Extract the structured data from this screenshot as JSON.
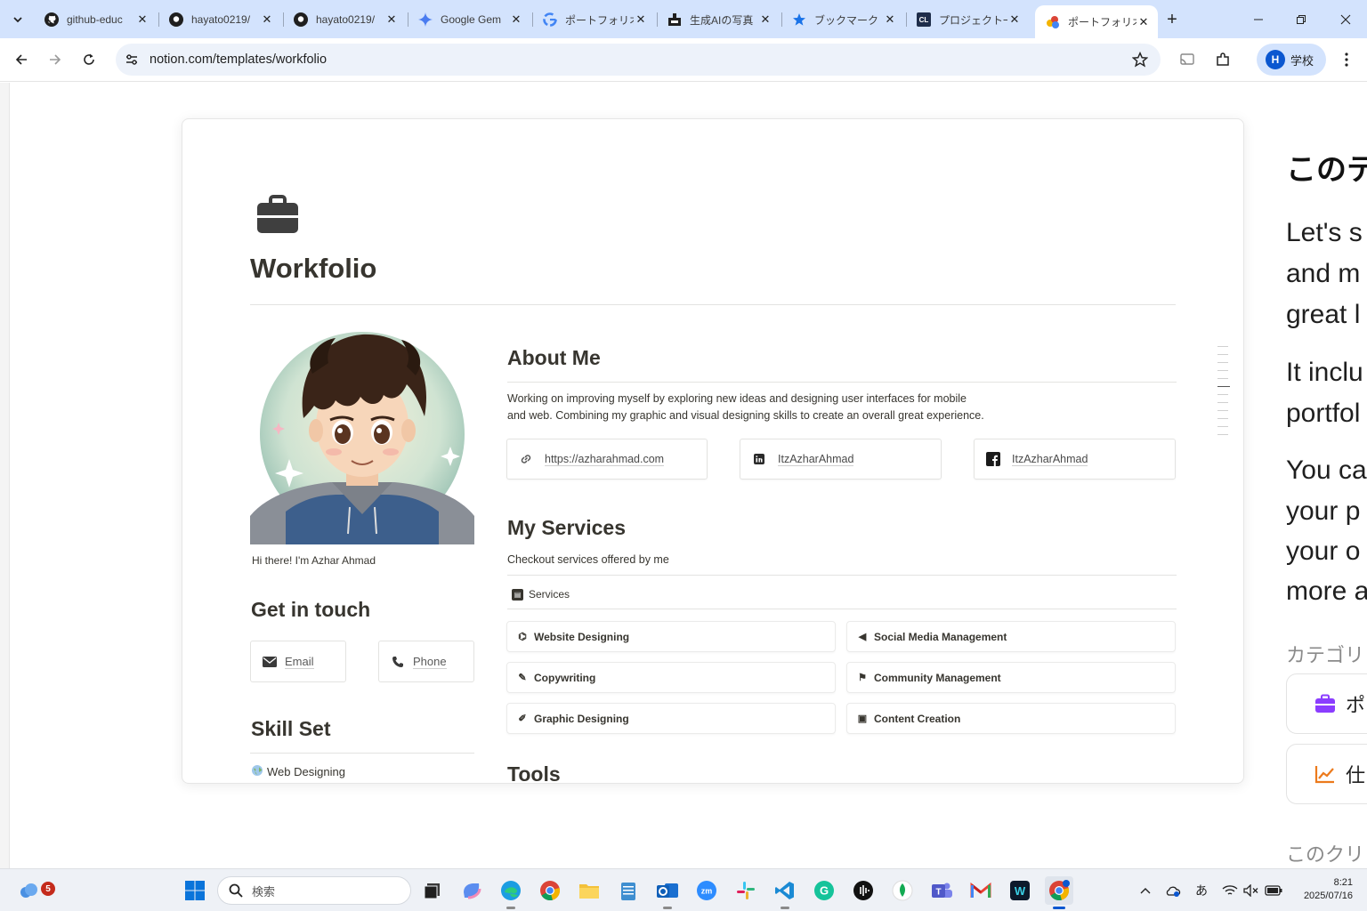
{
  "browser": {
    "tabs": [
      {
        "title": "github-educ",
        "icon": "github-icon"
      },
      {
        "title": "hayato0219/",
        "icon": "github-icon"
      },
      {
        "title": "hayato0219/",
        "icon": "github-icon"
      },
      {
        "title": "Google Gem",
        "icon": "gemini-icon"
      },
      {
        "title": "ポートフォリオ",
        "icon": "google-icon"
      },
      {
        "title": "生成AIの写真",
        "icon": "site-icon"
      },
      {
        "title": "ブックマーク",
        "icon": "star-icon"
      },
      {
        "title": "プロジェクト一",
        "icon": "cl-icon",
        "icon_text": "CL"
      },
      {
        "title": "ポートフォリオ",
        "icon": "notion-multicolor-icon",
        "active": true
      }
    ],
    "url": "notion.com/templates/workfolio",
    "profile_label": "学校",
    "profile_initial": "H"
  },
  "template": {
    "title": "Workfolio",
    "caption": "Hi there! I'm Azhar Ahmad",
    "about": {
      "heading": "About Me",
      "text_line1": "Working on improving myself by exploring new ideas and designing user interfaces for mobile",
      "text_line2": "and web. Combining my graphic and visual designing skills to create an overall great experience.",
      "links": [
        {
          "label": "https://azharahmad.com",
          "icon": "link-icon"
        },
        {
          "label": "ItzAzharAhmad",
          "icon": "linkedin-icon"
        },
        {
          "label": "ItzAzharAhmad",
          "icon": "facebook-icon"
        }
      ]
    },
    "services": {
      "heading": "My Services",
      "subtitle": "Checkout services offered by me",
      "db_label": "Services",
      "items": [
        {
          "label": "Website Designing",
          "icon": "web-icon"
        },
        {
          "label": "Social Media Management",
          "icon": "megaphone-icon"
        },
        {
          "label": "Copywriting",
          "icon": "pen-icon"
        },
        {
          "label": "Community Management",
          "icon": "community-icon"
        },
        {
          "label": "Graphic Designing",
          "icon": "edit-icon"
        },
        {
          "label": "Content Creation",
          "icon": "content-icon"
        }
      ]
    },
    "contact": {
      "heading": "Get in  touch",
      "email": "Email",
      "phone": "Phone"
    },
    "skills": {
      "heading": "Skill Set",
      "first": "Web Designing"
    },
    "tools_heading": "Tools"
  },
  "side_panel": {
    "heading": "このテ",
    "lines_1": [
      "Let's s",
      "and m",
      "great l"
    ],
    "lines_2": [
      "It inclu",
      "portfol"
    ],
    "lines_3": [
      "You ca",
      "your p",
      "your o",
      "more a"
    ],
    "category_label": "カテゴリ",
    "cards": [
      "ポ",
      "仕"
    ],
    "bottom": "このクリ"
  },
  "taskbar": {
    "search_placeholder": "検索",
    "badge_count": "5",
    "time": "8:21",
    "date": "2025/07/16",
    "ime": "あ"
  },
  "colors": {
    "tab_strip": "#d3e3fd",
    "omnibox": "#edf2fa",
    "accent_blue": "#0b57d0",
    "notion_text": "#37352f",
    "purple_icon": "#8b3dff",
    "orange_icon": "#ec7a1c"
  }
}
